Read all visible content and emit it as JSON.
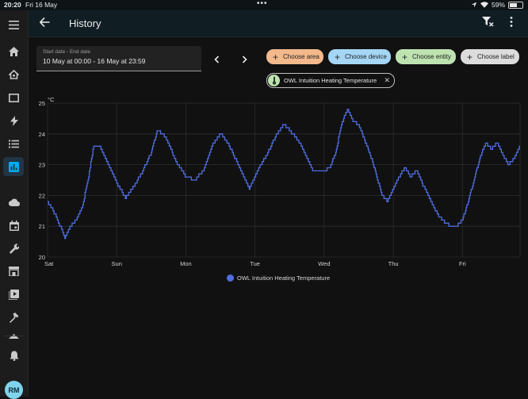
{
  "status_bar": {
    "time": "20:20",
    "date": "Fri 16 May",
    "dots": "•••",
    "battery": "59%",
    "battery_level": 0.59
  },
  "header": {
    "title": "History"
  },
  "date_picker": {
    "label": "Start date - End date",
    "value": "10 May at 00:00 - 16 May at 23:59"
  },
  "chips": {
    "area": "Choose area",
    "device": "Choose device",
    "entity": "Choose entity",
    "label": "Choose label"
  },
  "selected_entity": {
    "name": "OWL Intuition Heating Temperature"
  },
  "sidebar": {
    "avatar_initials": "RM"
  },
  "colors": {
    "series": "#4f6ee0",
    "accent": "#03a9f4",
    "background": "#111111"
  },
  "chart_data": {
    "type": "line",
    "y_unit": "°C",
    "ylim": [
      20,
      25
    ],
    "y_ticks": [
      "20",
      "21",
      "22",
      "23",
      "24",
      "25"
    ],
    "x_tick_labels": [
      "Sat",
      "Sun",
      "Mon",
      "Tue",
      "Wed",
      "Thu",
      "Fri"
    ],
    "x_range_hours": [
      0,
      164
    ],
    "grid": true,
    "legend": "bottom-center",
    "series": [
      {
        "name": "OWL Intuition Heating Temperature",
        "x_hours": [
          0,
          3,
          6,
          8,
          10,
          12,
          14,
          16,
          18,
          20,
          22,
          24,
          27,
          30,
          33,
          36,
          38,
          40,
          42,
          44,
          46,
          48,
          51,
          54,
          57,
          60,
          63,
          66,
          68,
          70,
          72,
          74,
          76,
          79,
          82,
          85,
          88,
          90,
          92,
          94,
          96,
          98,
          100,
          102,
          104,
          106,
          108,
          110,
          112,
          114,
          116,
          118,
          120,
          122,
          124,
          126,
          128,
          130,
          132,
          134,
          136,
          138,
          140,
          142,
          144,
          146,
          148,
          150,
          152,
          154,
          156,
          158,
          160,
          162,
          164
        ],
        "values": [
          21.8,
          21.3,
          20.6,
          21.0,
          21.2,
          21.6,
          22.5,
          23.6,
          23.6,
          23.2,
          22.8,
          22.4,
          21.9,
          22.3,
          22.8,
          23.4,
          24.1,
          24.0,
          23.7,
          23.2,
          22.9,
          22.6,
          22.5,
          22.8,
          23.6,
          24.0,
          23.6,
          23.0,
          22.6,
          22.2,
          22.6,
          23.0,
          23.3,
          23.9,
          24.3,
          24.0,
          23.6,
          23.2,
          22.8,
          22.8,
          22.8,
          22.9,
          23.4,
          24.3,
          24.8,
          24.4,
          24.3,
          23.8,
          23.3,
          22.7,
          22.0,
          21.8,
          22.2,
          22.6,
          22.9,
          22.6,
          22.8,
          22.4,
          22.0,
          21.6,
          21.3,
          21.1,
          21.0,
          21.0,
          21.2,
          21.8,
          22.5,
          23.2,
          23.7,
          23.5,
          23.7,
          23.3,
          23.0,
          23.2,
          23.6
        ]
      }
    ]
  }
}
